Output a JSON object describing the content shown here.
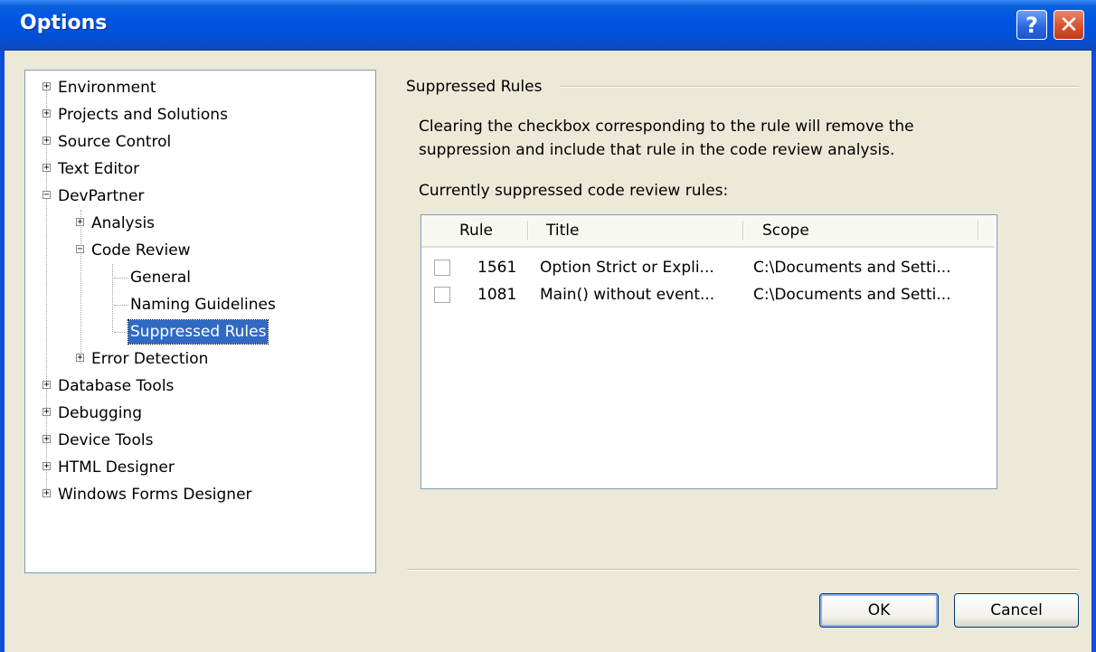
{
  "window": {
    "title": "Options",
    "help_icon": "help-icon",
    "close_icon": "close-icon",
    "help_glyph": "?",
    "close_glyph": "✕"
  },
  "tree": {
    "items": [
      {
        "label": "Environment",
        "expander": "+"
      },
      {
        "label": "Projects and Solutions",
        "expander": "+"
      },
      {
        "label": "Source Control",
        "expander": "+"
      },
      {
        "label": "Text Editor",
        "expander": "+"
      },
      {
        "label": "DevPartner",
        "expander": "−"
      },
      {
        "label": "Analysis",
        "expander": "+"
      },
      {
        "label": "Code Review",
        "expander": "−"
      },
      {
        "label": "General",
        "expander": ""
      },
      {
        "label": "Naming Guidelines",
        "expander": ""
      },
      {
        "label": "Suppressed Rules",
        "expander": "",
        "selected": true
      },
      {
        "label": "Error Detection",
        "expander": "+"
      },
      {
        "label": "Database Tools",
        "expander": "+"
      },
      {
        "label": "Debugging",
        "expander": "+"
      },
      {
        "label": "Device Tools",
        "expander": "+"
      },
      {
        "label": "HTML Designer",
        "expander": "+"
      },
      {
        "label": "Windows Forms Designer",
        "expander": "+"
      }
    ]
  },
  "panel": {
    "group_label": "Suppressed Rules",
    "description_line1": "Clearing the checkbox corresponding to the rule will remove the",
    "description_line2": "suppression and include that rule in the code review analysis.",
    "list_caption": "Currently suppressed code review rules:",
    "columns": [
      "Rule",
      "Title",
      "Scope"
    ],
    "rows": [
      {
        "checked": false,
        "rule": "1561",
        "title": "Option Strict or Expli...",
        "scope": "C:\\Documents and Setti..."
      },
      {
        "checked": false,
        "rule": "1081",
        "title": "Main() without event...",
        "scope": "C:\\Documents and Setti..."
      }
    ]
  },
  "buttons": {
    "ok": "OK",
    "cancel": "Cancel"
  },
  "colors": {
    "titlebar": "#0054e3",
    "selection": "#316ac5",
    "dialog_bg": "#ece9d8"
  }
}
